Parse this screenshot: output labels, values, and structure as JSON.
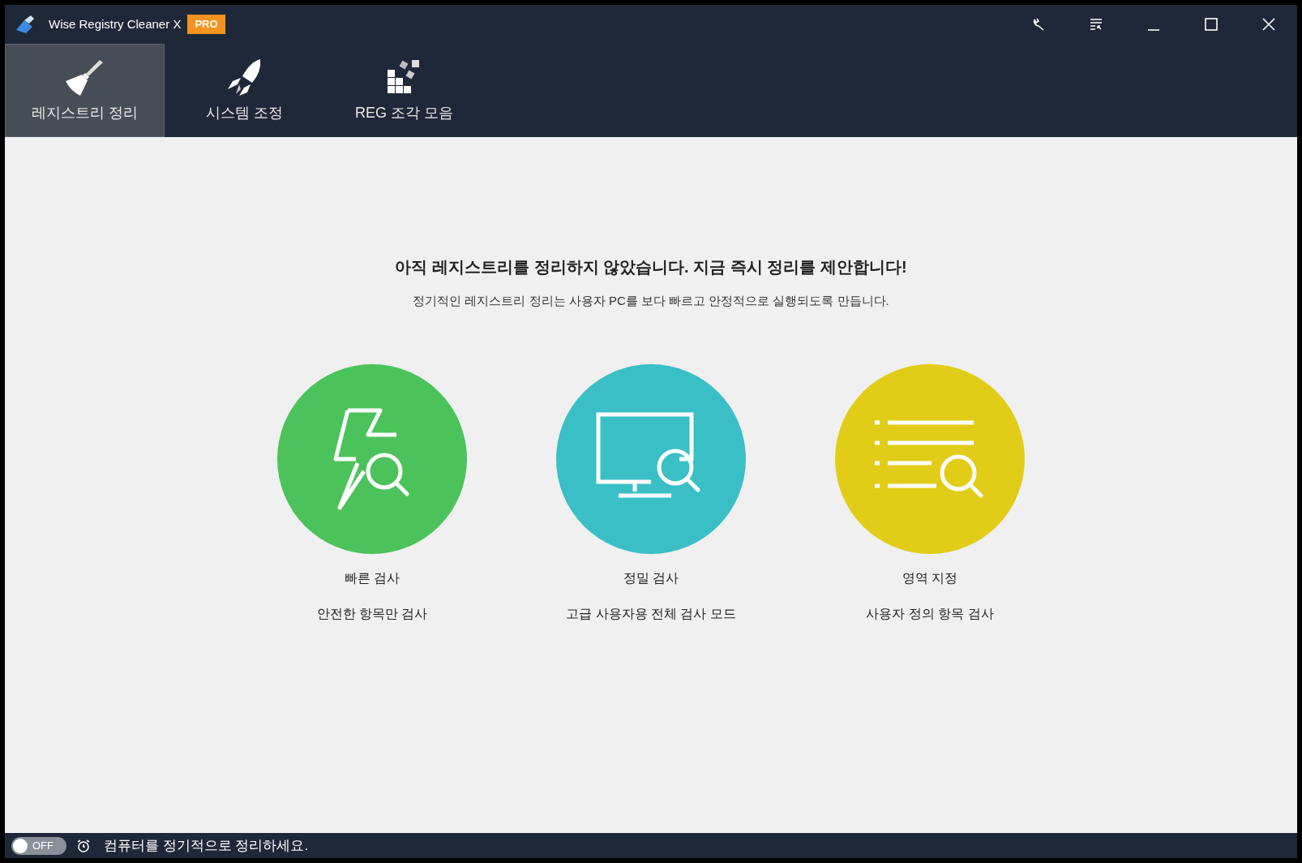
{
  "window": {
    "title": "Wise Registry Cleaner X",
    "badge": "PRO"
  },
  "tabs": [
    {
      "label": "레지스트리 정리",
      "kind": "broom",
      "selected": true
    },
    {
      "label": "시스템 조정",
      "kind": "rocket",
      "selected": false
    },
    {
      "label": "REG 조각 모음",
      "kind": "blocks",
      "selected": false
    }
  ],
  "headline": "아직 레지스트리를 정리하지 않았습니다. 지금 즉시 정리를 제안합니다!",
  "subline": "정기적인 레지스트리 정리는 사용자 PC를 보다 빠르고 안정적으로 실행되도록 만듭니다.",
  "scans": [
    {
      "kind": "fast",
      "color": "#4cc35a",
      "title": "빠른 검사",
      "description": "안전한 항목만 검사"
    },
    {
      "kind": "deep",
      "color": "#3bbfc6",
      "title": "정밀 검사",
      "description": "고급 사용자용 전체 검사 모드"
    },
    {
      "kind": "custom",
      "color": "#e1cd18",
      "title": "영역 지정",
      "description": "사용자 정의 항목 검사"
    }
  ],
  "status_bar": {
    "toggle": {
      "label": "OFF",
      "on": false
    },
    "message": "컴퓨터를 정기적으로 정리하세요."
  }
}
